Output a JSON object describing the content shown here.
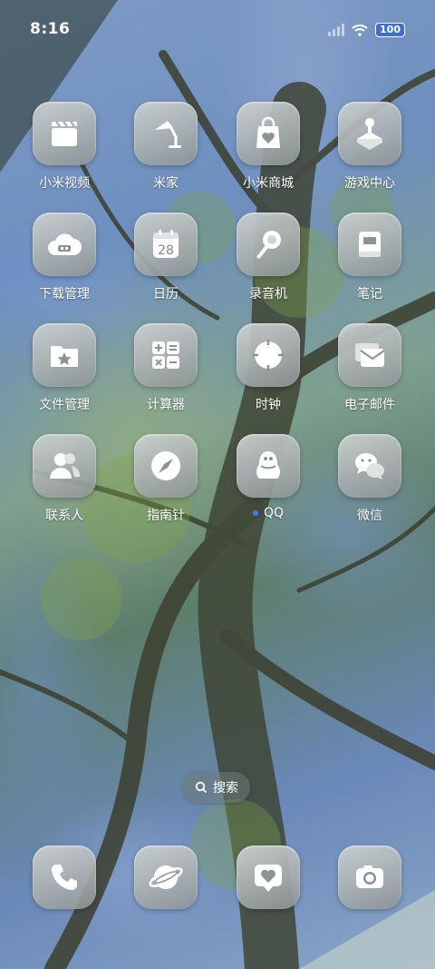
{
  "status_bar": {
    "time": "8:16",
    "battery": "100"
  },
  "apps": [
    {
      "label": "小米视频",
      "icon": "clapperboard-icon"
    },
    {
      "label": "米家",
      "icon": "desk-lamp-icon"
    },
    {
      "label": "小米商城",
      "icon": "shopping-bag-heart-icon"
    },
    {
      "label": "游戏中心",
      "icon": "joystick-icon"
    },
    {
      "label": "下载管理",
      "icon": "cloud-download-icon"
    },
    {
      "label": "日历",
      "icon": "calendar-icon",
      "calendar_day": "28"
    },
    {
      "label": "录音机",
      "icon": "microphone-icon"
    },
    {
      "label": "笔记",
      "icon": "notebook-icon"
    },
    {
      "label": "文件管理",
      "icon": "folder-star-icon"
    },
    {
      "label": "计算器",
      "icon": "calculator-icon"
    },
    {
      "label": "时钟",
      "icon": "clock-icon"
    },
    {
      "label": "电子邮件",
      "icon": "envelope-icon"
    },
    {
      "label": "联系人",
      "icon": "contacts-icon"
    },
    {
      "label": "指南针",
      "icon": "compass-icon"
    },
    {
      "label": "QQ",
      "icon": "penguin-icon",
      "new_dot": true
    },
    {
      "label": "微信",
      "icon": "chat-bubbles-icon"
    }
  ],
  "search": {
    "label": "搜索"
  },
  "dock": [
    {
      "icon": "phone-icon"
    },
    {
      "icon": "browser-planet-icon"
    },
    {
      "icon": "heart-message-icon"
    },
    {
      "icon": "camera-icon"
    }
  ],
  "colors": {
    "notification_dot": "#3a7bff",
    "battery_fill": "#3d6fd6"
  }
}
